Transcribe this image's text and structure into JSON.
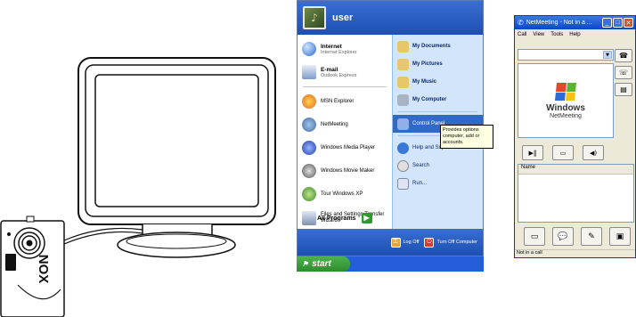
{
  "camera": {
    "brand": "NOX"
  },
  "start_menu": {
    "user_name": "user",
    "pinned": [
      {
        "label": "Internet",
        "sub": "Internet Explorer",
        "icon": "internet-explorer-icon"
      },
      {
        "label": "E-mail",
        "sub": "Outlook Express",
        "icon": "outlook-express-icon"
      }
    ],
    "recent": [
      {
        "label": "MSN Explorer",
        "icon": "msn-icon"
      },
      {
        "label": "NetMeeting",
        "icon": "netmeeting-icon"
      },
      {
        "label": "Windows Media Player",
        "icon": "media-player-icon"
      },
      {
        "label": "Windows Movie Maker",
        "icon": "movie-maker-icon"
      },
      {
        "label": "Tour Windows XP",
        "icon": "tour-icon"
      },
      {
        "label": "Files and Settings Transfer Wizard",
        "icon": "transfer-wizard-icon"
      }
    ],
    "all_programs": "All Programs",
    "right": [
      {
        "label": "My Documents",
        "icon": "folder-icon"
      },
      {
        "label": "My Pictures",
        "icon": "pictures-icon"
      },
      {
        "label": "My Music",
        "icon": "music-icon"
      },
      {
        "label": "My Computer",
        "icon": "computer-icon"
      }
    ],
    "control_panel": "Control Panel",
    "help": "Help and Sup",
    "search": "Search",
    "run": "Run...",
    "tooltip": "Provides options computer, add or accounts.",
    "log_off": "Log Off",
    "turn_off": "Turn Off Computer",
    "start": "start"
  },
  "netmeeting": {
    "title": "NetMeeting - Not in a ...",
    "menu": [
      "Call",
      "View",
      "Tools",
      "Help"
    ],
    "logo_line1": "Windows",
    "logo_line2": "NetMeeting",
    "list_header": "Name",
    "status": "Not in a call",
    "colors": {
      "flag": [
        "#e8452c",
        "#5ab331",
        "#2d6ad6",
        "#f6c114"
      ]
    }
  }
}
